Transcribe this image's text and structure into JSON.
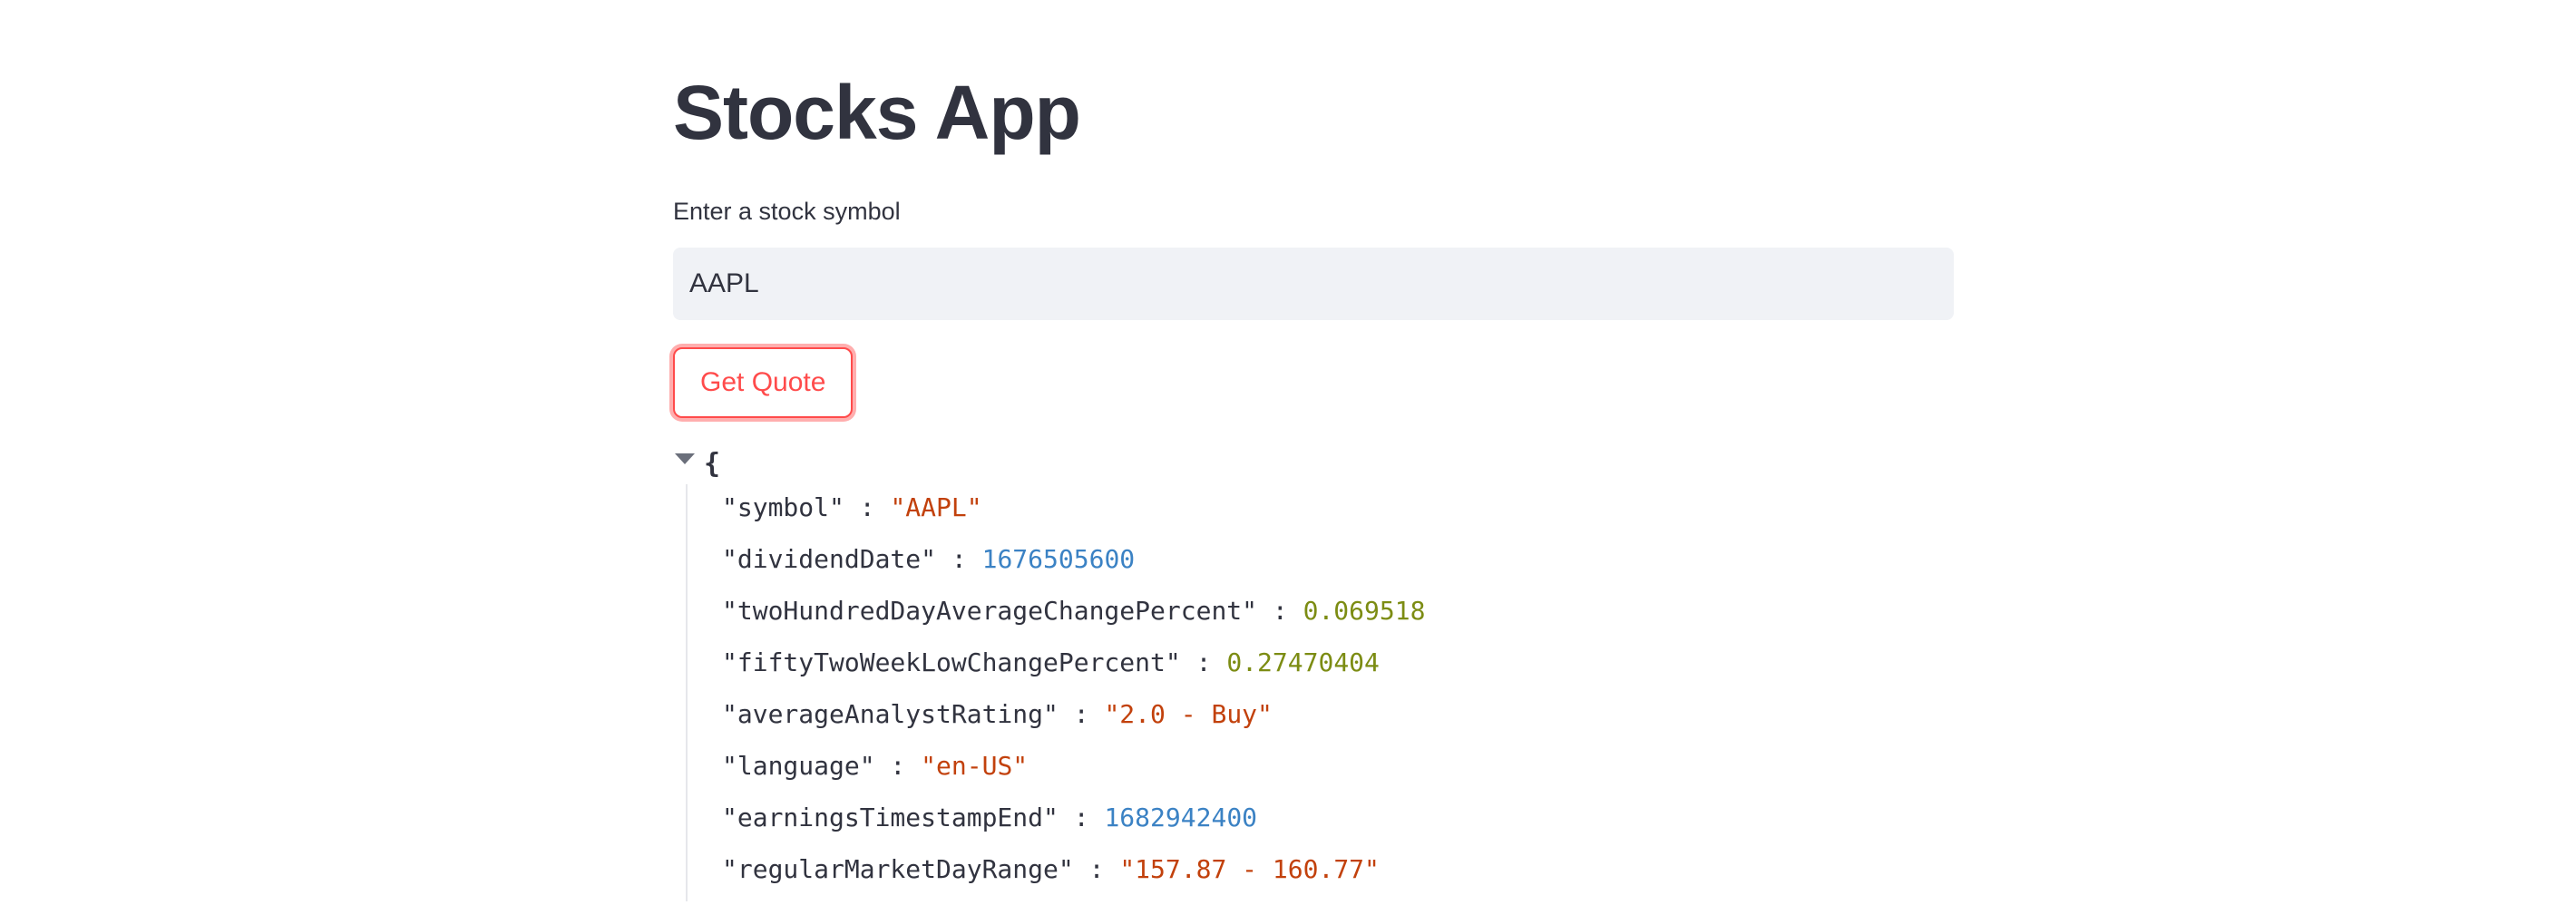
{
  "app": {
    "title": "Stocks App"
  },
  "form": {
    "label": "Enter a stock symbol",
    "input_value": "AAPL",
    "button_label": "Get Quote"
  },
  "json_view": {
    "open_brace": "{",
    "rows": [
      {
        "key": "\"symbol\"",
        "value": "\"AAPL\"",
        "kind": "str"
      },
      {
        "key": "\"dividendDate\"",
        "value": "1676505600",
        "kind": "num"
      },
      {
        "key": "\"twoHundredDayAverageChangePercent\"",
        "value": "0.069518",
        "kind": "flt"
      },
      {
        "key": "\"fiftyTwoWeekLowChangePercent\"",
        "value": "0.27470404",
        "kind": "flt"
      },
      {
        "key": "\"averageAnalystRating\"",
        "value": "\"2.0 - Buy\"",
        "kind": "str"
      },
      {
        "key": "\"language\"",
        "value": "\"en-US\"",
        "kind": "str"
      },
      {
        "key": "\"earningsTimestampEnd\"",
        "value": "1682942400",
        "kind": "num"
      },
      {
        "key": "\"regularMarketDayRange\"",
        "value": "\"157.87 - 160.77\"",
        "kind": "str"
      }
    ]
  },
  "colors": {
    "accent": "#ff4b4b",
    "string_value": "#c2410c",
    "integer_value": "#3b82c4",
    "float_value": "#7c8c13",
    "text": "#31333f",
    "input_bg": "#f0f2f6"
  }
}
